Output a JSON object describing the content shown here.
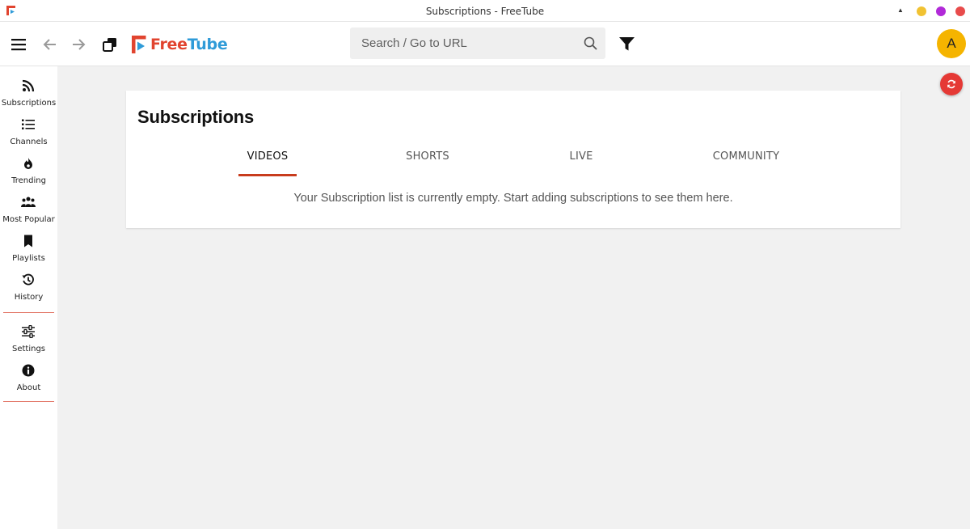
{
  "window": {
    "title": "Subscriptions - FreeTube",
    "controls": [
      {
        "name": "minimize",
        "color": "#f1c232"
      },
      {
        "name": "maximize",
        "color": "#b12ad8"
      },
      {
        "name": "close",
        "color": "#e84b4b"
      }
    ]
  },
  "header": {
    "logo_free": "Free",
    "logo_tube": "Tube",
    "search_placeholder": "Search / Go to URL",
    "avatar_letter": "A",
    "icons": [
      "menu-icon",
      "back-arrow-icon",
      "forward-arrow-icon",
      "new-window-icon",
      "filter-icon",
      "search-icon"
    ]
  },
  "sidebar": {
    "items": [
      {
        "label": "Subscriptions",
        "icon": "rss-icon"
      },
      {
        "label": "Channels",
        "icon": "list-icon"
      },
      {
        "label": "Trending",
        "icon": "fire-icon"
      },
      {
        "label": "Most Popular",
        "icon": "users-icon"
      },
      {
        "label": "Playlists",
        "icon": "bookmark-icon"
      },
      {
        "label": "History",
        "icon": "history-icon"
      },
      {
        "label": "Settings",
        "icon": "sliders-icon"
      },
      {
        "label": "About",
        "icon": "info-icon"
      }
    ]
  },
  "main": {
    "title": "Subscriptions",
    "tabs": [
      {
        "label": "VIDEOS",
        "active": true
      },
      {
        "label": "SHORTS",
        "active": false
      },
      {
        "label": "LIVE",
        "active": false
      },
      {
        "label": "COMMUNITY",
        "active": false
      }
    ],
    "empty_message": "Your Subscription list is currently empty. Start adding subscriptions to see them here."
  },
  "colors": {
    "accent": "#c83c1d",
    "refresh_button": "#e53935",
    "avatar": "#f5b400",
    "logo_red": "#e1442f",
    "logo_blue": "#2f9bd8"
  }
}
